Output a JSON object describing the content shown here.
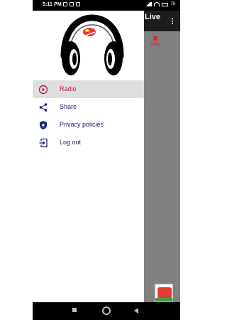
{
  "status_bar": {
    "time": "5:11 PM",
    "battery": "79"
  },
  "app": {
    "title": "Live",
    "stop_label": "Stop",
    "accent": "#d32f2f"
  },
  "drawer": {
    "items": [
      {
        "label": "Radio",
        "icon": "radio-icon",
        "active": true
      },
      {
        "label": "Share",
        "icon": "share-icon",
        "active": false
      },
      {
        "label": "Privacy policies",
        "icon": "shield-icon",
        "active": false
      },
      {
        "label": "Log out",
        "icon": "logout-icon",
        "active": false
      }
    ],
    "active_color": "#c2185b",
    "text_color": "#1a237e"
  },
  "nav_bar": {
    "icons": [
      "recent-apps-icon",
      "home-icon",
      "back-icon"
    ]
  }
}
